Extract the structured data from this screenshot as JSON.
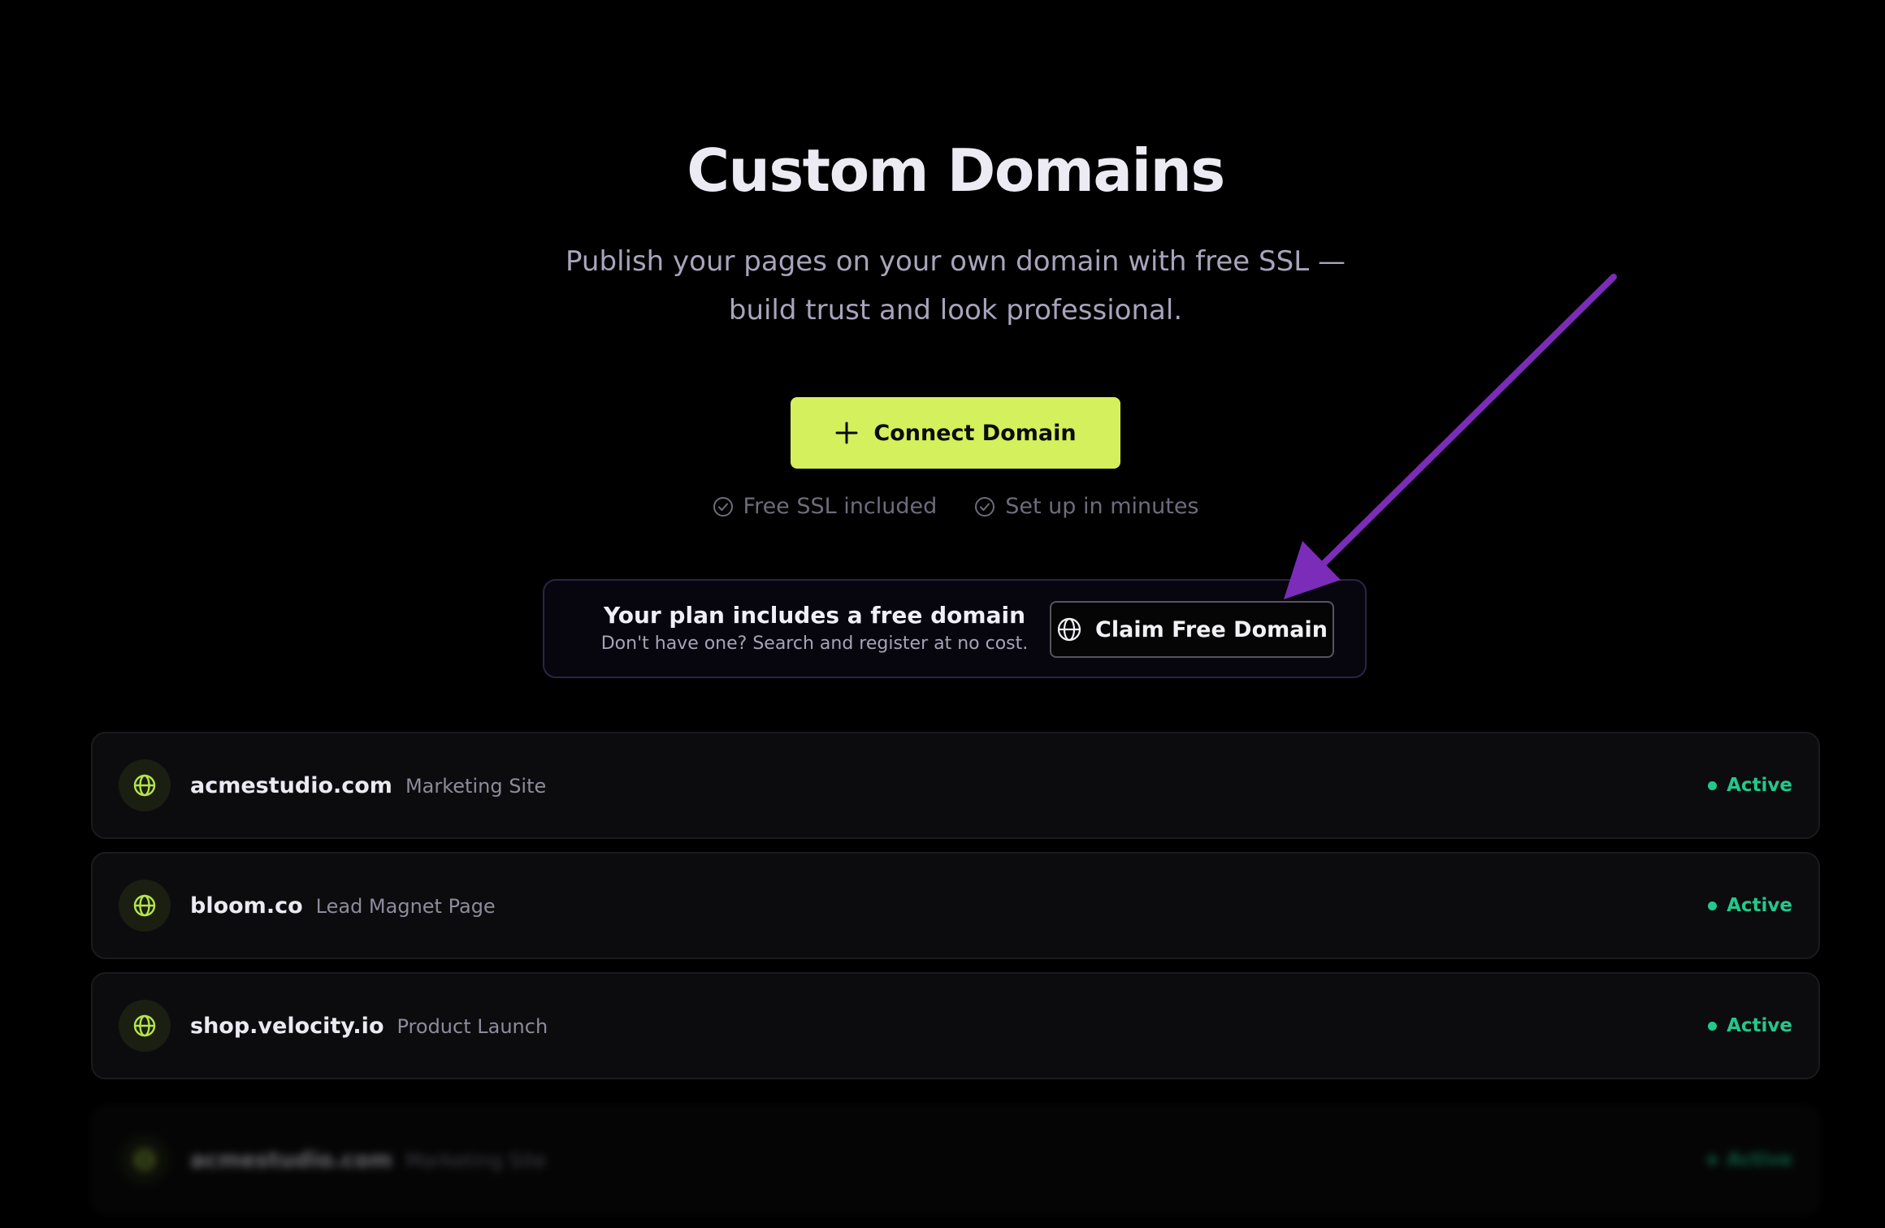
{
  "header": {
    "title": "Custom Domains",
    "subtitle_line1": "Publish your pages on your own domain with free SSL —",
    "subtitle_line2": "build trust and look professional."
  },
  "actions": {
    "connect_label": "Connect Domain",
    "connect_icon": "plus-icon"
  },
  "features": [
    {
      "label": "Free SSL included",
      "icon": "check-circle-icon"
    },
    {
      "label": "Set up in minutes",
      "icon": "check-circle-icon"
    }
  ],
  "promo": {
    "title": "Your plan includes a free domain",
    "subtitle": "Don't have one? Search and register at no cost.",
    "button_label": "Claim Free Domain",
    "button_icon": "globe-icon"
  },
  "domains": [
    {
      "name": "acmestudio.com",
      "label": "Marketing Site",
      "status": "Active"
    },
    {
      "name": "bloom.co",
      "label": "Lead Magnet Page",
      "status": "Active"
    },
    {
      "name": "shop.velocity.io",
      "label": "Product Launch",
      "status": "Active"
    },
    {
      "name": "acmestudio.com",
      "label": "Marketing Site",
      "status": "Active"
    }
  ],
  "colors": {
    "background": "#000000",
    "accent": "#d4f05c",
    "status_active": "#22c98c",
    "annotation_arrow": "#7b2cb8"
  }
}
